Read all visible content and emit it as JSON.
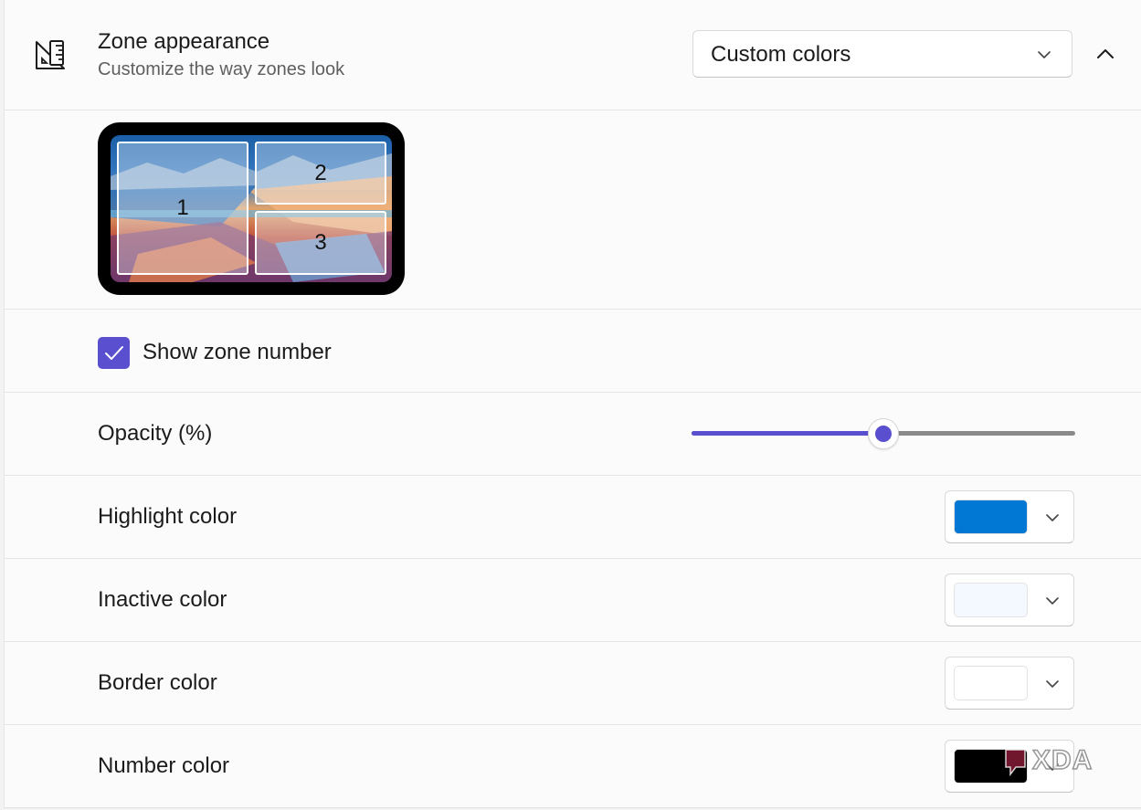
{
  "header": {
    "title": "Zone appearance",
    "subtitle": "Customize the way zones look",
    "icon": "ruler-triangle-icon",
    "dropdown_value": "Custom colors",
    "collapse_icon": "chevron-up-icon"
  },
  "preview": {
    "zones": [
      "1",
      "2",
      "3"
    ]
  },
  "show_zone_number": {
    "label": "Show zone number",
    "checked": true,
    "accent_color": "#5a4fcf"
  },
  "opacity": {
    "label": "Opacity (%)",
    "value_percent": 50
  },
  "colors": [
    {
      "label": "Highlight color",
      "value": "#0078d4"
    },
    {
      "label": "Inactive color",
      "value": "#f3f9ff"
    },
    {
      "label": "Border color",
      "value": "#ffffff"
    },
    {
      "label": "Number color",
      "value": "#000000"
    }
  ],
  "watermark": {
    "text": "XDA"
  }
}
